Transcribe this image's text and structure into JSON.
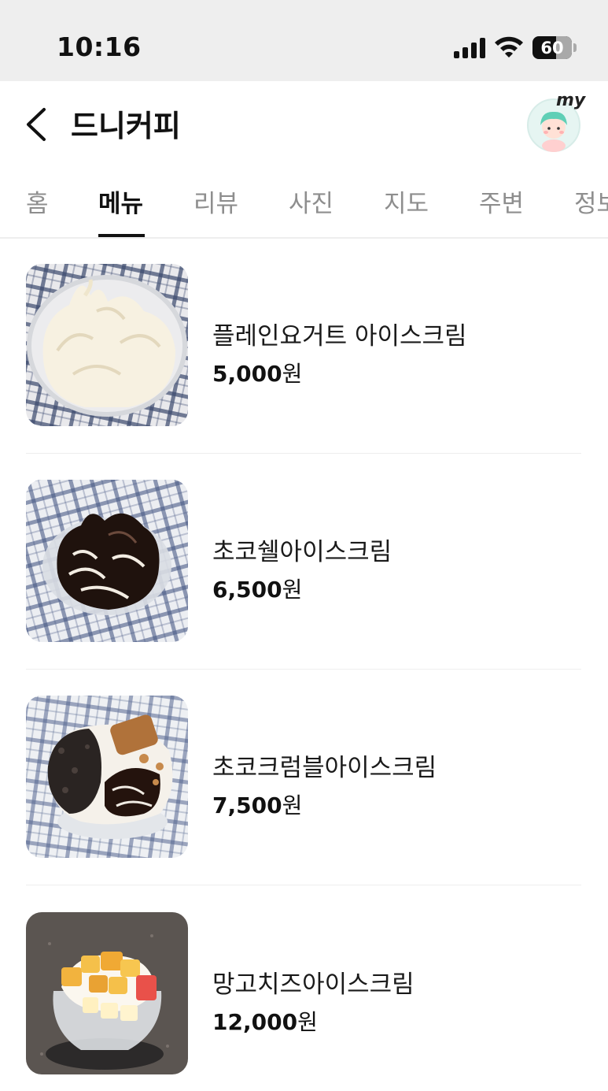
{
  "status_bar": {
    "time": "10:16",
    "battery": "60",
    "battery_level_percent": 60
  },
  "header": {
    "title": "드니커피",
    "my_label": "my"
  },
  "tabs": [
    {
      "label": "홈",
      "active": false
    },
    {
      "label": "메뉴",
      "active": true
    },
    {
      "label": "리뷰",
      "active": false
    },
    {
      "label": "사진",
      "active": false
    },
    {
      "label": "지도",
      "active": false
    },
    {
      "label": "주변",
      "active": false
    },
    {
      "label": "정보",
      "active": false
    }
  ],
  "menu": [
    {
      "name": "플레인요거트 아이스크림",
      "price_number": "5,000",
      "price_unit": "원"
    },
    {
      "name": "초코쉘아이스크림",
      "price_number": "6,500",
      "price_unit": "원"
    },
    {
      "name": "초코크럼블아이스크림",
      "price_number": "7,500",
      "price_unit": "원"
    },
    {
      "name": "망고치즈아이스크림",
      "price_number": "12,000",
      "price_unit": "원"
    }
  ],
  "colors": {
    "active_tab": "#111111",
    "inactive_tab": "#8e8e8e",
    "status_bg": "#eeeeee"
  }
}
